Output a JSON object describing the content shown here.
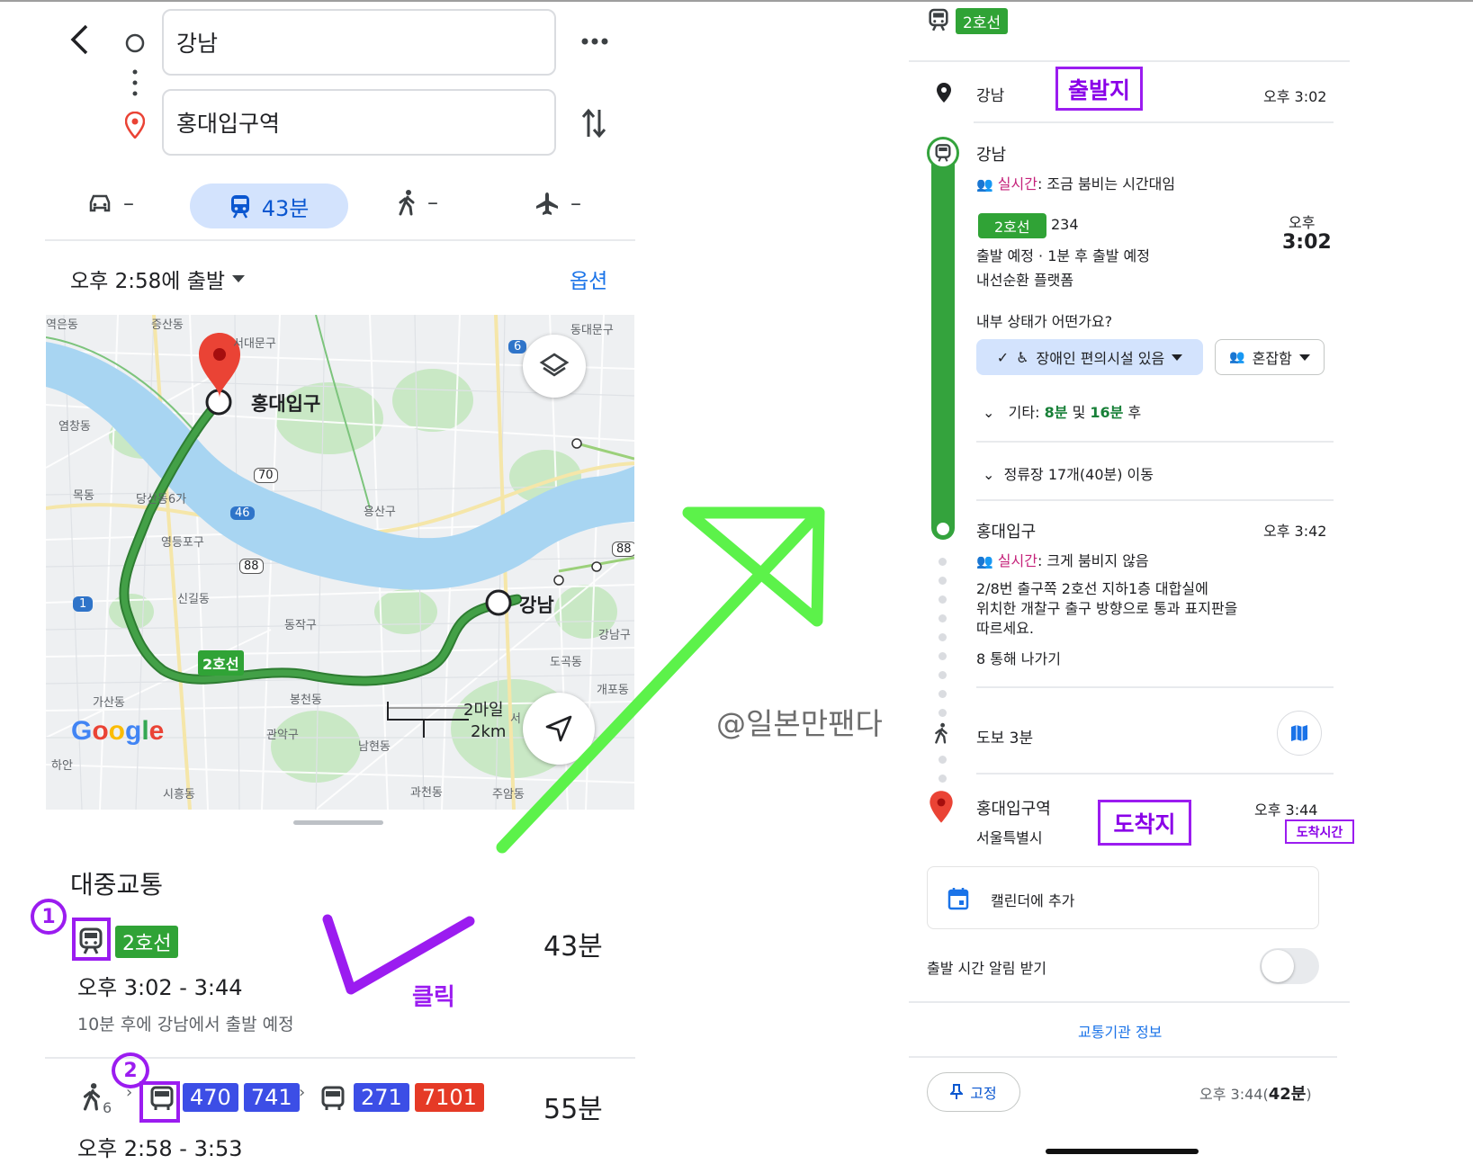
{
  "left": {
    "origin_field": "강남",
    "destination_field": "홍대입구역",
    "modes": {
      "car": "–",
      "transit": "43분",
      "walk": "–",
      "flight": "–"
    },
    "depart_time": "오후 2:58에 출발",
    "options": "옵션",
    "map_labels": {
      "hongdae": "홍대입구",
      "gangnam": "강남",
      "line2": "2호선",
      "scale_miles": "2마일",
      "scale_km": "2km",
      "places": [
        "증산동",
        "서대문구",
        "동대문구",
        "염창동",
        "목동",
        "당산동6가",
        "영등포구",
        "용산구",
        "신길동",
        "동작구",
        "가산동",
        "관악구",
        "남현동",
        "봉천동",
        "서",
        "개포동",
        "도곡동",
        "강남구",
        "과천동",
        "주암동",
        "시흥동",
        "하안",
        "역은동"
      ],
      "route_shields": [
        "70",
        "46",
        "88",
        "88",
        "1",
        "6"
      ]
    },
    "section_title": "대중교통",
    "route1": {
      "line": "2호선",
      "duration": "43분",
      "time": "오후 3:02 - 3:44",
      "note": "10분 후에 강남에서 출발 예정"
    },
    "route2": {
      "walk_minutes": "6",
      "buses_a": [
        "470",
        "741"
      ],
      "buses_b": [
        "271",
        "7101"
      ],
      "duration": "55분",
      "time": "오후 2:58 - 3:53"
    },
    "annotations": {
      "num1": "1",
      "num2": "2",
      "click": "클릭"
    }
  },
  "watermark": "@일본만팬다",
  "right": {
    "header_line": "2호선",
    "origin": {
      "name": "강남",
      "time": "오후 3:02"
    },
    "station": {
      "name": "강남",
      "realtime_label": "실시간",
      "realtime_text": ": 조금 붐비는 시간대임",
      "line": "2호선",
      "train_no": "234",
      "time_label": "오후",
      "time": "3:02",
      "status": "출발 예정 · 1분 후 출발 예정",
      "platform": "내선순환 플랫폼",
      "question": "내부 상태가 어떤가요?",
      "chip_access": "장애인 편의시설 있음",
      "chip_crowd": "혼잡함",
      "other_prefix": "기타:",
      "other_a": "8분",
      "other_mid": "및",
      "other_b": "16분",
      "other_suffix": "후",
      "stops": "정류장 17개(40분) 이동"
    },
    "arrive_station": {
      "name": "홍대입구",
      "time": "오후 3:42",
      "realtime_label": "실시간",
      "realtime_text": ": 크게 붐비지 않음",
      "directions_1": "2/8번 출구쪽 2호선 지하1층 대합실에",
      "directions_2": "위치한 개찰구 출구 방향으로 통과 표지판을",
      "directions_3": "따르세요.",
      "exit": "8 통해 나가기"
    },
    "walk": "도보 3분",
    "destination": {
      "name": "홍대입구역",
      "city": "서울특별시",
      "time": "오후 3:44"
    },
    "calendar": "캘린더에 추가",
    "alert": "출발 시간 알림 받기",
    "agency": "교통기관 정보",
    "pin": "고정",
    "arrival_prefix": "오후 3:44(",
    "arrival_bold": "42분",
    "arrival_suffix": ")",
    "annotations": {
      "origin_label": "출발지",
      "dest_label": "도착지",
      "arrive_time_label": "도착시간"
    }
  },
  "colors": {
    "line2": "#30a336",
    "bus_blue": "#3c4ee6",
    "bus_red": "#e53a26",
    "annotation_purple": "#9b1cf0",
    "arrow_green": "#5cf24a",
    "google_blue": "#1a73e8"
  }
}
